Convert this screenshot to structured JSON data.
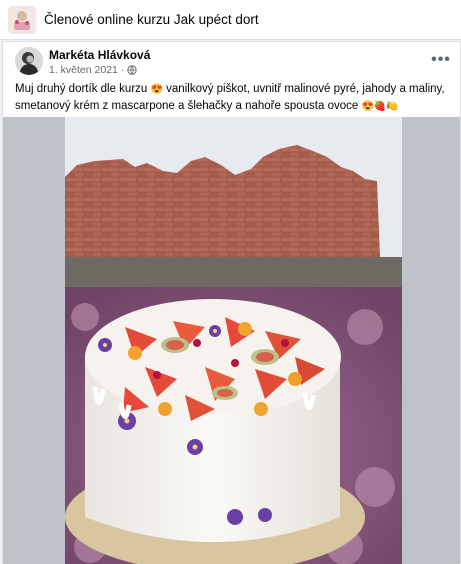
{
  "group": {
    "title": "Členové online kurzu Jak upéct dort"
  },
  "post": {
    "author": "Markéta Hlávková",
    "date": "1. květen 2021",
    "separator": "·",
    "more_label": "•••",
    "text_line1_a": "Muj druhý dortík dle kurzu",
    "text_line1_emoji": "😍",
    "text_line1_b": " vanilkový piškot, uvnitř malinové pyré, jahody a maliny,",
    "text_line2_a": "smetanový krém z mascarpone a šlehačky a nahoře spousta ovoce",
    "text_line2_emoji": "😍🍓🍋"
  },
  "colors": {
    "wall_sky": "#e9ecef",
    "brick": "#a6584a",
    "heather": "#8c5b7d",
    "cream": "#f4f1ec"
  },
  "icons": {
    "globe": "globe-icon",
    "more": "more-options-icon"
  }
}
